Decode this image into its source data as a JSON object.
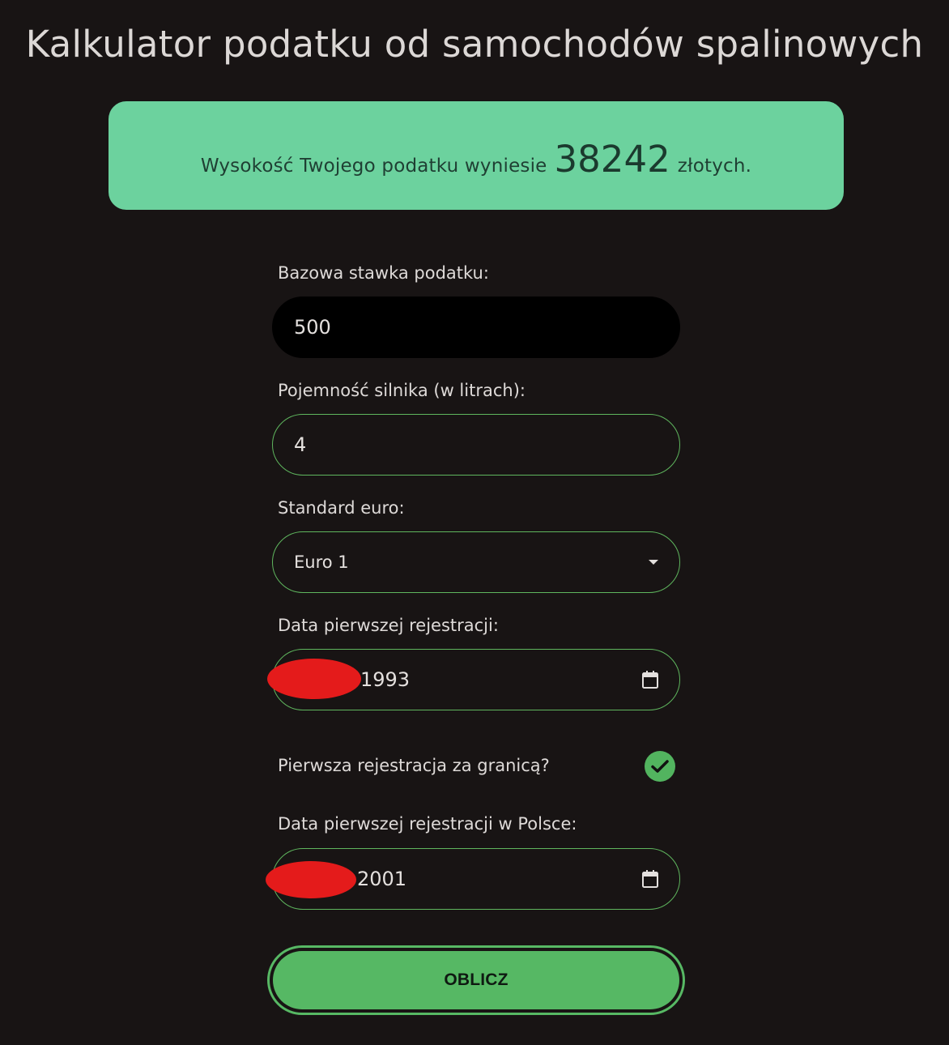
{
  "page": {
    "title": "Kalkulator podatku od samochodów spalinowych"
  },
  "result": {
    "prefix": "Wysokość Twojego podatku wyniesie",
    "amount": "38242",
    "suffix": "złotych."
  },
  "form": {
    "base_rate": {
      "label": "Bazowa stawka podatku:",
      "value": "500"
    },
    "engine_capacity": {
      "label": "Pojemność silnika (w litrach):",
      "value": "4"
    },
    "euro_standard": {
      "label": "Standard euro:",
      "selected": "Euro 1"
    },
    "first_registration_date": {
      "label": "Data pierwszej rejestracji:",
      "visible_value": "1993"
    },
    "registered_abroad": {
      "label": "Pierwsza rejestracja za granicą?",
      "checked": true
    },
    "first_registration_poland_date": {
      "label": "Data pierwszej rejestracji w Polsce:",
      "visible_value": "2001"
    },
    "submit_label": "OBLICZ"
  },
  "colors": {
    "background": "#181414",
    "banner": "#6cd29e",
    "accent_green": "#56b864",
    "redaction": "#e41b1b"
  },
  "icons": {
    "select": "chevron-down-icon",
    "date": "calendar-icon",
    "check": "checkmark-icon"
  }
}
